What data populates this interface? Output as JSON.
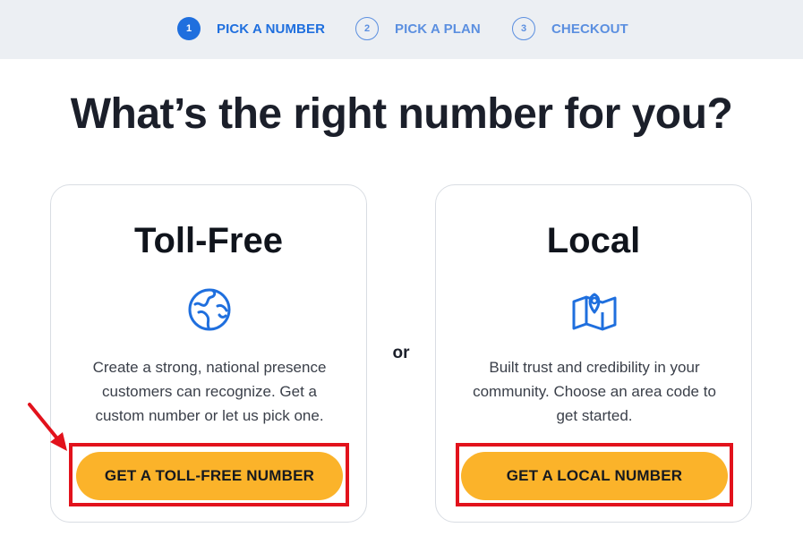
{
  "stepper": {
    "steps": [
      {
        "number": "1",
        "label": "PICK A NUMBER",
        "state": "active"
      },
      {
        "number": "2",
        "label": "PICK A PLAN",
        "state": "inactive"
      },
      {
        "number": "3",
        "label": "CHECKOUT",
        "state": "inactive"
      }
    ]
  },
  "headline": "What’s the right number for you?",
  "separator": "or",
  "cards": [
    {
      "title": "Toll-Free",
      "icon": "globe-icon",
      "description": "Create a strong, national presence customers can recognize. Get a custom number or let us pick one.",
      "button": "GET A TOLL-FREE NUMBER"
    },
    {
      "title": "Local",
      "icon": "map-pin-icon",
      "description": "Built trust and credibility in your community. Choose an area code to get started.",
      "button": "GET A LOCAL NUMBER"
    }
  ],
  "colors": {
    "accent": "#1f6fde",
    "button": "#fbb32a",
    "annotation": "#e2121c"
  }
}
